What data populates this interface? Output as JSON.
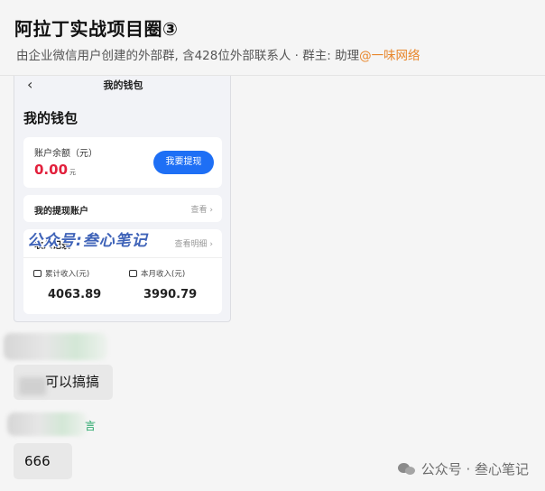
{
  "header": {
    "title": "阿拉丁实战项目圈③",
    "subtitle_prefix": "由企业微信用户创建的外部群, 含428位外部联系人 · 群主: 助理",
    "admin_name": "@一味网络"
  },
  "screenshot": {
    "back_glyph": "‹",
    "topbar_title": "我的钱包",
    "big_title": "我的钱包",
    "balance_label": "账户余额（元）",
    "balance_value": "0.00",
    "balance_unit": "元",
    "withdraw_label": "我要提现",
    "accounts_title": "我的提现账户",
    "accounts_link": "查看",
    "income_title": "收入记录",
    "income_link": "查看明细",
    "total_label": "累计收入(元)",
    "total_value": "4063.89",
    "month_label": "本月收入(元)",
    "month_value": "3990.79",
    "watermark": "公众号:叁心笔记"
  },
  "messages": [
    {
      "text": "可以搞搞"
    },
    {
      "name_tail": "言",
      "text": "666"
    }
  ],
  "footer": {
    "watermark": "公众号 · 叁心笔记"
  },
  "colors": {
    "accent_blue": "#1e6ff5",
    "amount_red": "#e2203c",
    "admin_orange": "#e8862a"
  }
}
